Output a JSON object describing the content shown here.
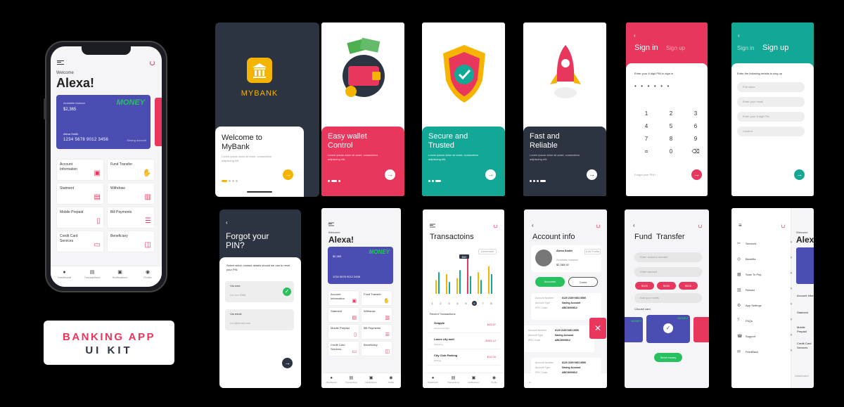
{
  "colors": {
    "brand_red": "#e8365d",
    "teal": "#12a895",
    "navy": "#2d3441",
    "card_blue": "#4b4db3",
    "yellow": "#f5b400",
    "green": "#29c15f"
  },
  "kit_title": {
    "line1": "BANKING APP",
    "line2": "UI KIT"
  },
  "dashboard": {
    "welcome": "Welcome",
    "user": "Alexa!",
    "card": {
      "balance_label": "Available balance",
      "balance": "$2,365",
      "brand": "MONEY",
      "holder": "Alexa Smith",
      "number": "1234 5678 9012 3456",
      "bank": "Saving account"
    },
    "tiles": [
      {
        "label": "Account Information",
        "icon": "user-card-icon"
      },
      {
        "label": "Fund Transfer",
        "icon": "hand-coins-icon"
      },
      {
        "label": "Statment",
        "icon": "document-icon"
      },
      {
        "label": "Withdraw",
        "icon": "atm-icon"
      },
      {
        "label": "Mobile Prepaid",
        "icon": "mobile-icon"
      },
      {
        "label": "Bill Payments",
        "icon": "bill-icon"
      },
      {
        "label": "Credit Card Services",
        "icon": "credit-card-icon"
      },
      {
        "label": "Beneficiary",
        "icon": "contacts-icon"
      }
    ],
    "tabs": [
      "Dashboard",
      "Transactions",
      "Notifications",
      "Profile"
    ]
  },
  "splash": {
    "brand": "MYBANK"
  },
  "onboarding": [
    {
      "title": "Welcome to MyBank",
      "body": "Lorem ipsum dolor sit amet, consectetur adipiscing elit."
    },
    {
      "title": "Easy wallet Control",
      "body": "Lorem ipsum dolor sit amet, consectetur adipiscing elit."
    },
    {
      "title": "Secure and Trusted",
      "body": "Lorem ipsum dolor sit amet, consectetur adipiscing elit."
    },
    {
      "title": "Fast and Reliable",
      "body": "Lorem ipsum dolor sit amet, consectetur adipiscing elit."
    }
  ],
  "signin": {
    "tab_active": "Sign in",
    "tab_other": "Sign up",
    "prompt": "Enter your 6 digit PIN to sign in",
    "keys": [
      "1",
      "2",
      "3",
      "4",
      "5",
      "6",
      "7",
      "8",
      "9",
      "⌗",
      "0",
      "⌫"
    ],
    "forgot": "Forgot your PIN?"
  },
  "signup": {
    "tab_other": "Sign in",
    "tab_active": "Sign up",
    "prompt": "Enter the following details to sing up",
    "fields": [
      "Full name",
      "Enter your email",
      "Enter your 6 digit PIN",
      "Confirm"
    ]
  },
  "forgot": {
    "title": "Forgot your PIN?",
    "body": "Select which contact details should we use to reset your PIN",
    "via_sms": "Via sms:",
    "sms_value": "•••• •••• 1966",
    "via_email": "Via email",
    "email_value": "•••••@email.com"
  },
  "transactions": {
    "title": "Transactoins",
    "period": "December",
    "tooltip": "$60",
    "recent": "Recent Transactions",
    "items": [
      {
        "name": "Grappie",
        "sub": "Account transfer",
        "amount": "$43.97"
      },
      {
        "name": "Lanes city mall",
        "sub": "Shopping",
        "amount": "-$453.12"
      },
      {
        "name": "City Club Parking",
        "sub": "Parking",
        "amount": "$12.00"
      }
    ],
    "days": [
      "1",
      "2",
      "3",
      "4",
      "5",
      "6",
      "7",
      "8"
    ]
  },
  "account_info": {
    "title": "Account info",
    "name": "Alexa Smith",
    "edit": "Edit Profile",
    "balance_label": "Available balance",
    "balance": "$2,365.92",
    "tabs": [
      "Accounts",
      "Cards"
    ],
    "accounts": [
      {
        "number": "6120 2169 9451 6550",
        "type": "Saving Account",
        "ifsc": "ABCD000612"
      },
      {
        "number": "6120 2169 9451 6550",
        "type": "Saving Account",
        "ifsc": "ABCD000612"
      },
      {
        "number": "6120 2169 9451 6550",
        "type": "Saving Account",
        "ifsc": "ABCD000612"
      }
    ],
    "labels": {
      "number": "Account Number",
      "type": "Account Type",
      "ifsc": "IFSC Code"
    }
  },
  "fund_transfer": {
    "title": "Fund  Transfer",
    "fields": [
      "Enter account number",
      "Enter amount",
      "Add your notes"
    ],
    "chips": [
      "$100",
      "$150",
      "$200"
    ],
    "choose": "Choose card",
    "button": "Send money",
    "card_brand": "MONEY"
  },
  "menu": {
    "items": [
      "Services",
      "Benefits",
      "Scan To Pay",
      "Reload",
      "App Settings",
      "FAQs",
      "Support",
      "FeedBack"
    ]
  }
}
